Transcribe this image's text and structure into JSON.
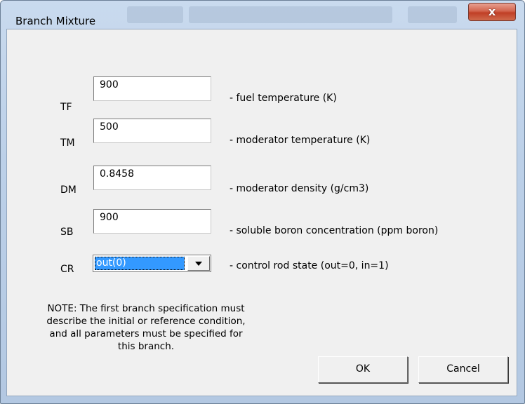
{
  "window": {
    "title": "Branch Mixture",
    "close_glyph": "x"
  },
  "fields": {
    "tf": {
      "label": "TF",
      "value": "900",
      "description": "- fuel temperature (K)"
    },
    "tm": {
      "label": "TM",
      "value": "500",
      "description": "- moderator temperature (K)"
    },
    "dm": {
      "label": "DM",
      "value": "0.8458",
      "description": "- moderator density (g/cm3)"
    },
    "sb": {
      "label": "SB",
      "value": "900",
      "description": "- soluble boron concentration (ppm boron)"
    },
    "cr": {
      "label": "CR",
      "selected": "out(0)",
      "description": "- control rod state (out=0, in=1)"
    }
  },
  "note": {
    "line1": "NOTE: The first branch specification must",
    "line2": "describe the initial or reference condition,",
    "line3": "and all parameters must be specified for",
    "line4": "this branch."
  },
  "buttons": {
    "ok": "OK",
    "cancel": "Cancel"
  },
  "icons": {
    "close": "close-icon",
    "dropdown": "chevron-down-icon"
  }
}
